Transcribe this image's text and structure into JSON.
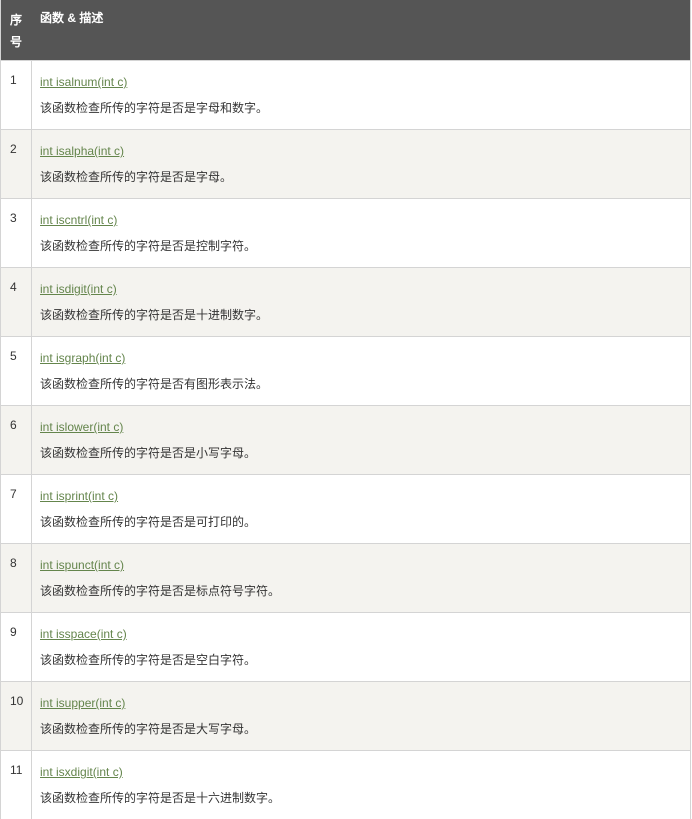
{
  "header": {
    "col1_line1": "序",
    "col1_line2": "号",
    "col2": "函数 & 描述"
  },
  "rows": [
    {
      "num": "1",
      "func": "int isalnum(int c)",
      "desc": "该函数检查所传的字符是否是字母和数字。"
    },
    {
      "num": "2",
      "func": "int isalpha(int c)",
      "desc": "该函数检查所传的字符是否是字母。"
    },
    {
      "num": "3",
      "func": "int iscntrl(int c)",
      "desc": "该函数检查所传的字符是否是控制字符。"
    },
    {
      "num": "4",
      "func": "int isdigit(int c)",
      "desc": "该函数检查所传的字符是否是十进制数字。"
    },
    {
      "num": "5",
      "func": "int isgraph(int c)",
      "desc": "该函数检查所传的字符是否有图形表示法。"
    },
    {
      "num": "6",
      "func": "int islower(int c)",
      "desc": "该函数检查所传的字符是否是小写字母。"
    },
    {
      "num": "7",
      "func": "int isprint(int c)",
      "desc": "该函数检查所传的字符是否是可打印的。"
    },
    {
      "num": "8",
      "func": "int ispunct(int c)",
      "desc": "该函数检查所传的字符是否是标点符号字符。"
    },
    {
      "num": "9",
      "func": "int isspace(int c)",
      "desc": "该函数检查所传的字符是否是空白字符。"
    },
    {
      "num": "10",
      "func": "int isupper(int c)",
      "desc": "该函数检查所传的字符是否是大写字母。"
    },
    {
      "num": "11",
      "func": "int isxdigit(int c)",
      "desc": "该函数检查所传的字符是否是十六进制数字。"
    }
  ],
  "colors": {
    "header_bg": "#555555",
    "link": "#64854c",
    "alt_row_bg": "#f4f3ef"
  }
}
